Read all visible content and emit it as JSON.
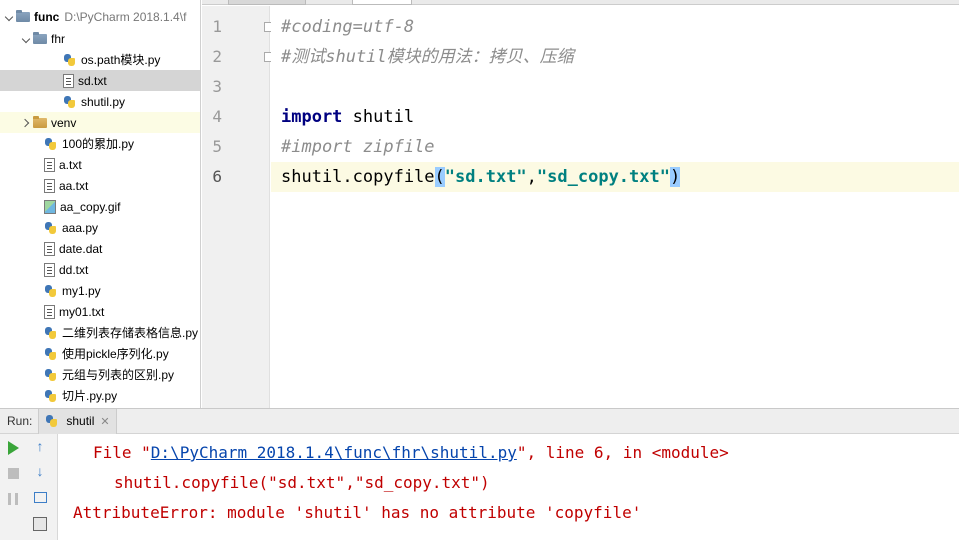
{
  "project_tree": {
    "root": {
      "label": "func",
      "path": "D:\\PyCharm 2018.1.4\\f"
    },
    "items": [
      {
        "label": "fhr",
        "kind": "folder",
        "expanded": true,
        "depth": 1
      },
      {
        "label": "os.path模块.py",
        "kind": "py",
        "depth": 2
      },
      {
        "label": "sd.txt",
        "kind": "txt",
        "depth": 2,
        "selected": true
      },
      {
        "label": "shutil.py",
        "kind": "py",
        "depth": 2
      },
      {
        "label": "venv",
        "kind": "folder-excluded",
        "expanded": false,
        "depth": 1
      },
      {
        "label": "100的累加.py",
        "kind": "py",
        "depth": 1
      },
      {
        "label": "a.txt",
        "kind": "txt",
        "depth": 1
      },
      {
        "label": "aa.txt",
        "kind": "txt",
        "depth": 1
      },
      {
        "label": "aa_copy.gif",
        "kind": "gif",
        "depth": 1
      },
      {
        "label": "aaa.py",
        "kind": "py",
        "depth": 1
      },
      {
        "label": "date.dat",
        "kind": "txt",
        "depth": 1
      },
      {
        "label": "dd.txt",
        "kind": "txt",
        "depth": 1
      },
      {
        "label": "my1.py",
        "kind": "py",
        "depth": 1
      },
      {
        "label": "my01.txt",
        "kind": "txt",
        "depth": 1
      },
      {
        "label": "二维列表存储表格信息.py",
        "kind": "py",
        "depth": 1
      },
      {
        "label": "使用pickle序列化.py",
        "kind": "py",
        "depth": 1
      },
      {
        "label": "元组与列表的区别.py",
        "kind": "py",
        "depth": 1
      },
      {
        "label": "切片.py.py",
        "kind": "py",
        "depth": 1
      }
    ]
  },
  "editor": {
    "line_numbers": [
      "1",
      "2",
      "3",
      "4",
      "5",
      "6"
    ],
    "current_line": 6,
    "lines": {
      "l1": "#coding=utf-8",
      "l2": "#测试shutil模块的用法：拷贝、压缩",
      "l3": "",
      "l4_kw": "import",
      "l4_rest": " shutil",
      "l5": "#import zipfile",
      "l6_call": "shutil.copyfile",
      "l6_open": "(",
      "l6_arg1": "\"sd.txt\"",
      "l6_comma": ",",
      "l6_arg2": "\"sd_copy.txt\"",
      "l6_close": ")"
    }
  },
  "run_panel": {
    "label": "Run:",
    "tab": "shutil",
    "console": {
      "line1_prefix": "File \"",
      "line1_link": "D:\\PyCharm 2018.1.4\\func\\fhr\\shutil.py",
      "line1_suffix": "\", line 6, in <module>",
      "line2": "shutil.copyfile(\"sd.txt\",\"sd_copy.txt\")",
      "line3": "AttributeError: module 'shutil' has no attribute 'copyfile'"
    }
  },
  "colors": {
    "error_text": "#c00000",
    "link": "#0645ad",
    "keyword": "#000080",
    "string": "#008080",
    "comment": "#8c8c8c",
    "current_line": "#fcfae3"
  }
}
